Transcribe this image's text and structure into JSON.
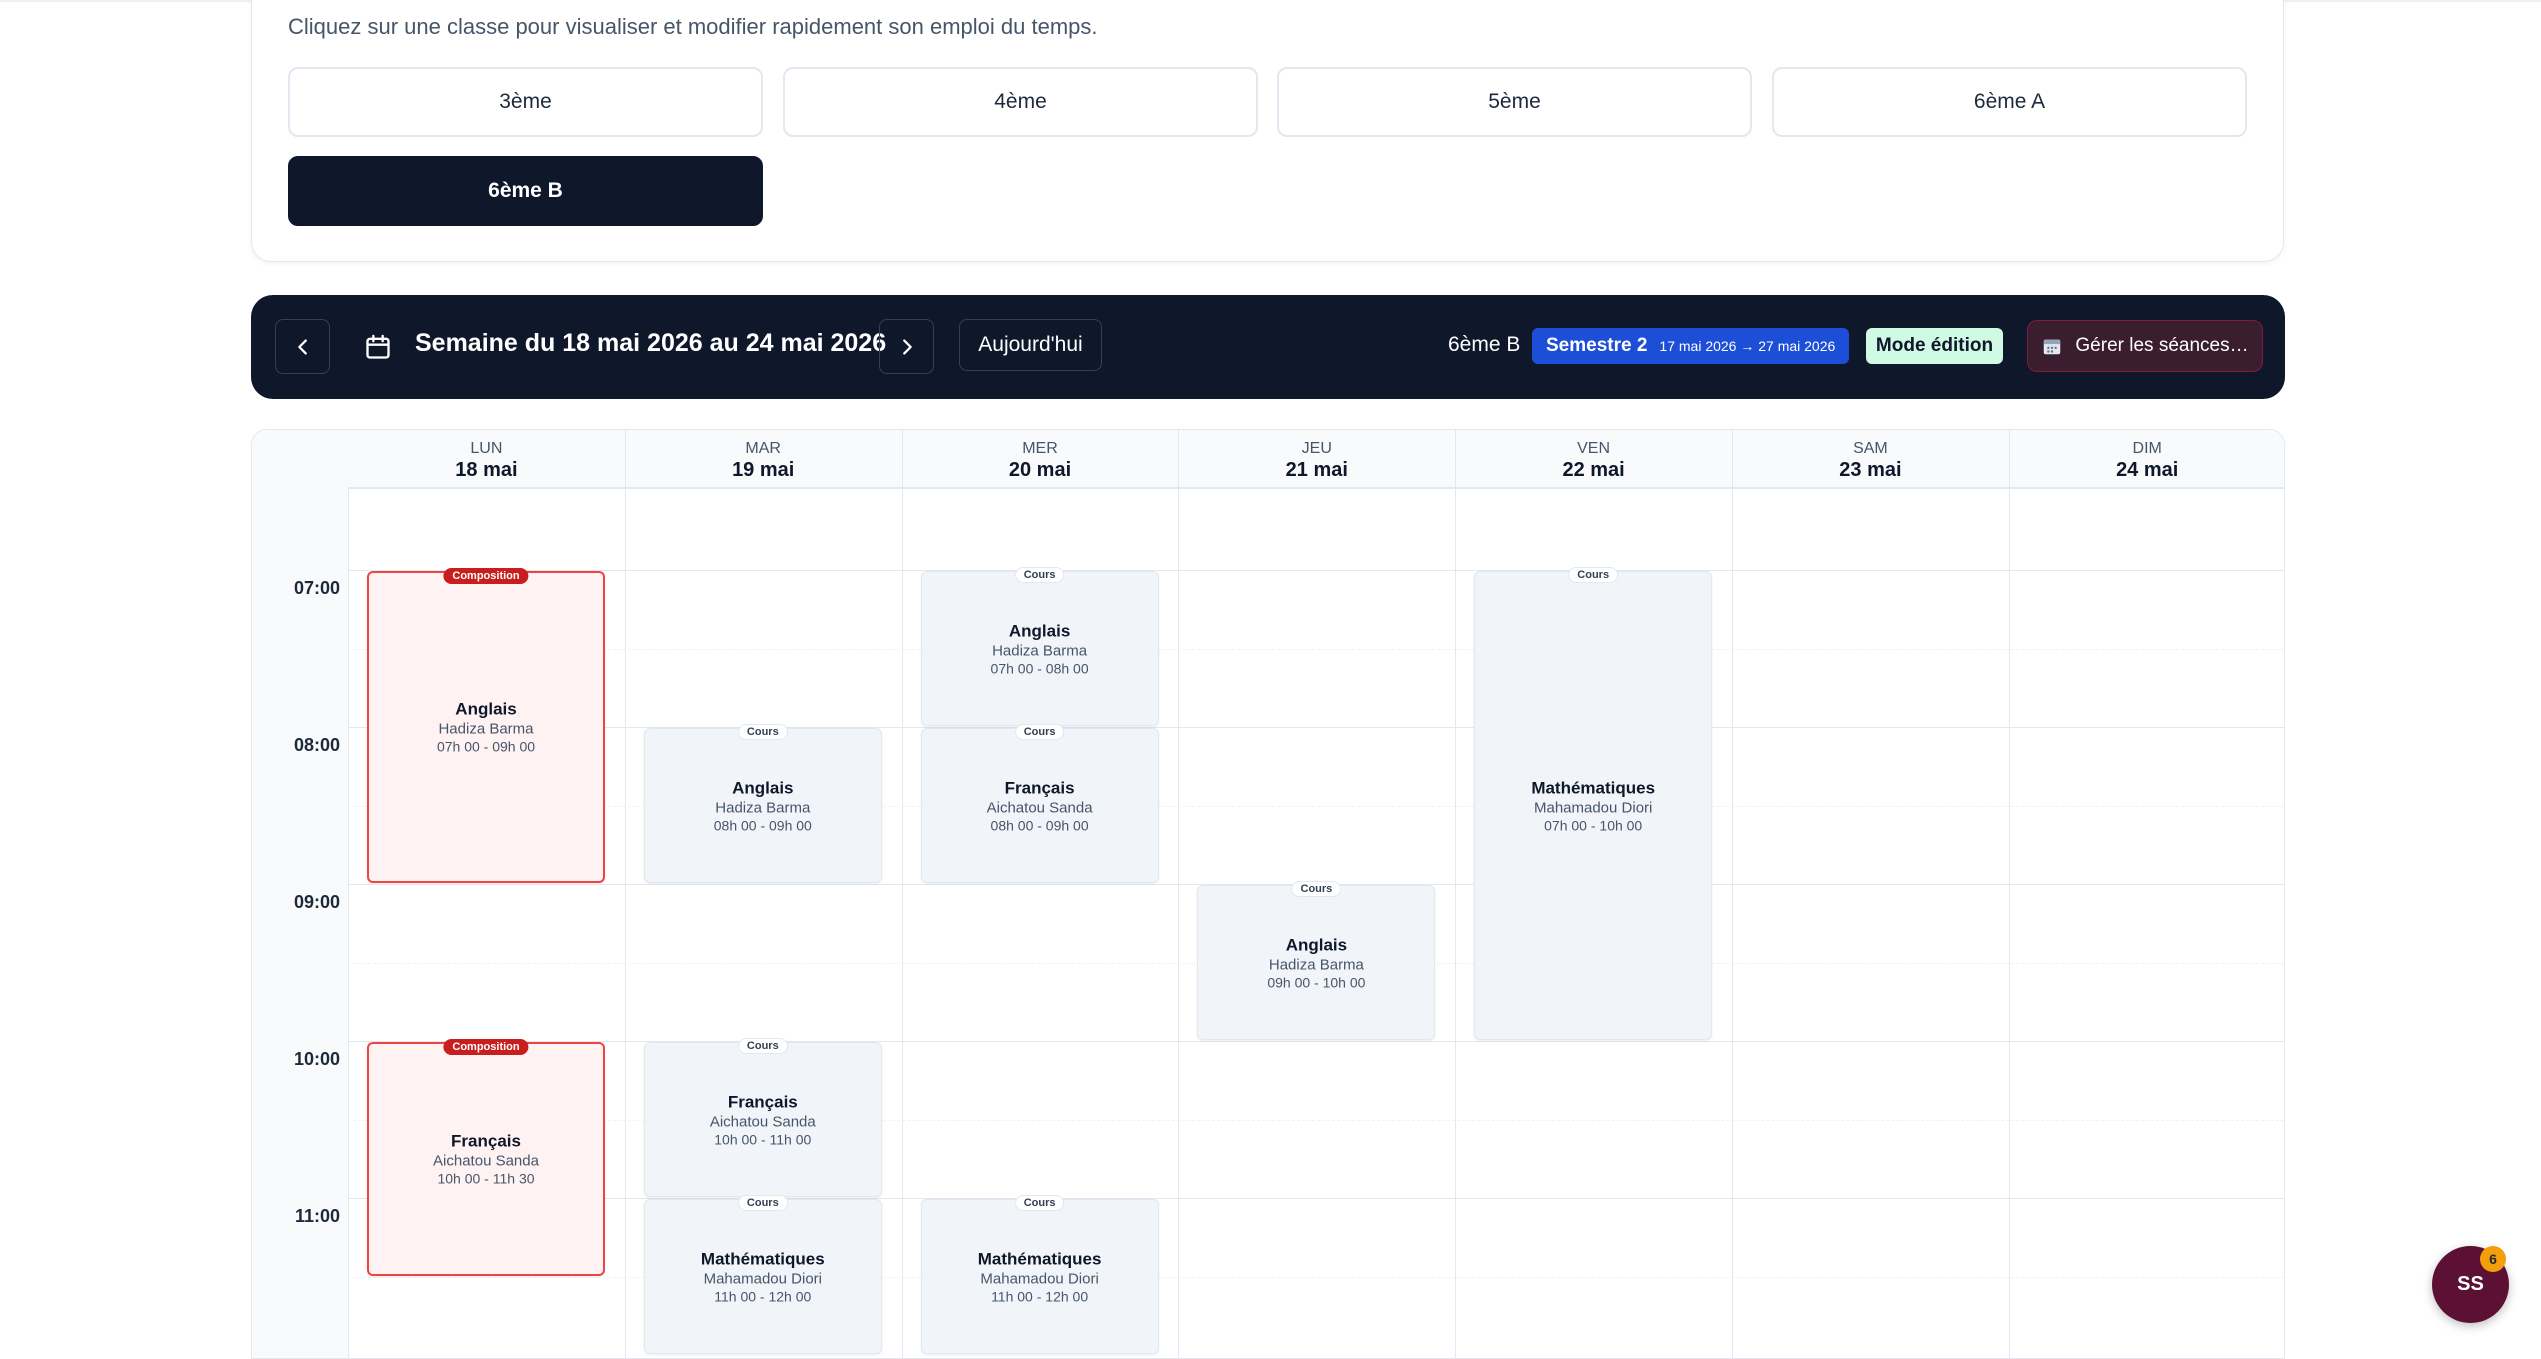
{
  "class_selector": {
    "subtitle": "Cliquez sur une classe pour visualiser et modifier rapidement son emploi du temps.",
    "classes": [
      "3ème",
      "4ème",
      "5ème",
      "6ème A",
      "6ème B"
    ],
    "selected": "6ème B"
  },
  "toolbar": {
    "week_title": "Semaine du 18 mai 2026 au 24 mai 2026",
    "today_label": "Aujourd'hui",
    "class_name": "6ème B",
    "semester_label": "Semestre 2",
    "semester_dates": "17 mai 2026 → 27 mai 2026",
    "mode_label": "Mode édition",
    "manage_label": "Gérer les séances…"
  },
  "calendar": {
    "days": [
      {
        "name": "LUN",
        "date": "18 mai"
      },
      {
        "name": "MAR",
        "date": "19 mai"
      },
      {
        "name": "MER",
        "date": "20 mai"
      },
      {
        "name": "JEU",
        "date": "21 mai"
      },
      {
        "name": "VEN",
        "date": "22 mai"
      },
      {
        "name": "SAM",
        "date": "23 mai"
      },
      {
        "name": "DIM",
        "date": "24 mai"
      }
    ],
    "hours": [
      "07:00",
      "08:00",
      "09:00",
      "10:00",
      "11:00"
    ],
    "events": [
      {
        "day": "LUN",
        "tag": "Composition",
        "subject": "Anglais",
        "teacher": "Hadiza Barma",
        "time": "07h 00 - 09h 00",
        "start": 7,
        "end": 9
      },
      {
        "day": "LUN",
        "tag": "Composition",
        "subject": "Français",
        "teacher": "Aichatou Sanda",
        "time": "10h 00 - 11h 30",
        "start": 10,
        "end": 11.5
      },
      {
        "day": "MAR",
        "tag": "Cours",
        "subject": "Anglais",
        "teacher": "Hadiza Barma",
        "time": "08h 00 - 09h 00",
        "start": 8,
        "end": 9
      },
      {
        "day": "MAR",
        "tag": "Cours",
        "subject": "Français",
        "teacher": "Aichatou Sanda",
        "time": "10h 00 - 11h 00",
        "start": 10,
        "end": 11
      },
      {
        "day": "MAR",
        "tag": "Cours",
        "subject": "Mathématiques",
        "teacher": "Mahamadou Diori",
        "time": "11h 00 - 12h 00",
        "start": 11,
        "end": 12
      },
      {
        "day": "MER",
        "tag": "Cours",
        "subject": "Anglais",
        "teacher": "Hadiza Barma",
        "time": "07h 00 - 08h 00",
        "start": 7,
        "end": 8
      },
      {
        "day": "MER",
        "tag": "Cours",
        "subject": "Français",
        "teacher": "Aichatou Sanda",
        "time": "08h 00 - 09h 00",
        "start": 8,
        "end": 9
      },
      {
        "day": "MER",
        "tag": "Cours",
        "subject": "Mathématiques",
        "teacher": "Mahamadou Diori",
        "time": "11h 00 - 12h 00",
        "start": 11,
        "end": 12
      },
      {
        "day": "JEU",
        "tag": "Cours",
        "subject": "Anglais",
        "teacher": "Hadiza Barma",
        "time": "09h 00 - 10h 00",
        "start": 9,
        "end": 10
      },
      {
        "day": "VEN",
        "tag": "Cours",
        "subject": "Mathématiques",
        "teacher": "Mahamadou Diori",
        "time": "07h 00 - 10h 00",
        "start": 7,
        "end": 10
      }
    ]
  },
  "user": {
    "initials": "SS",
    "notification_count": "6"
  }
}
